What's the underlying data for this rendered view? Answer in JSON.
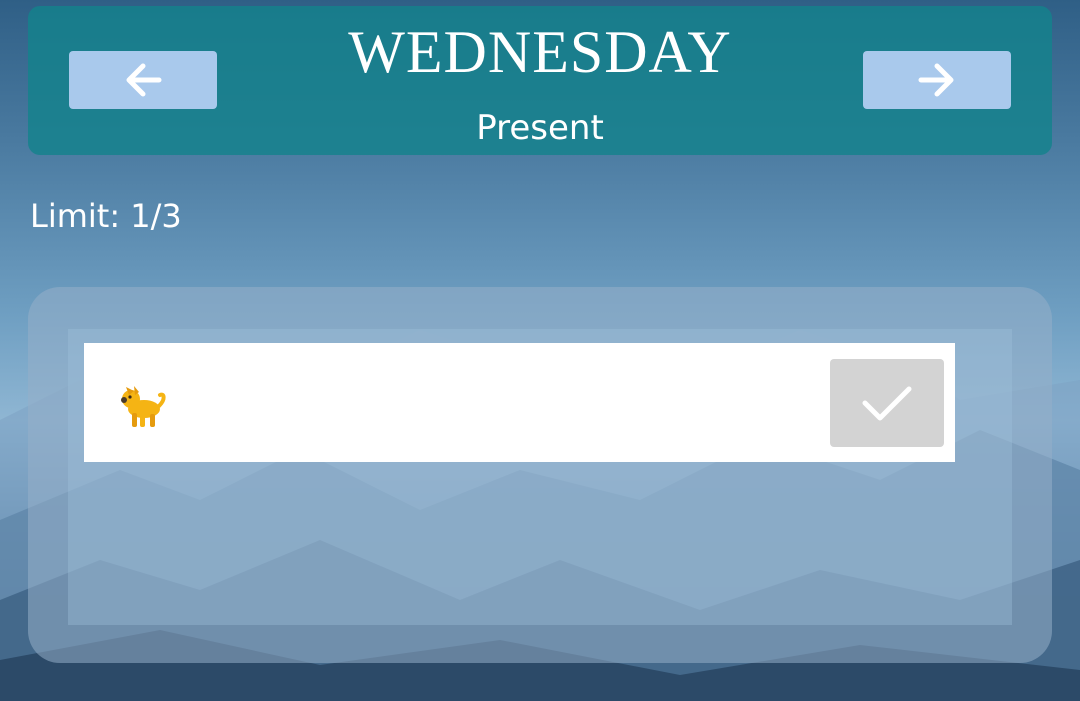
{
  "header": {
    "day": "WEDNESDAY",
    "subtitle": "Present",
    "prev_icon": "arrow-left-icon",
    "next_icon": "arrow-right-icon"
  },
  "limit": {
    "text": "Limit: 1/3"
  },
  "tasks": [
    {
      "emoji": "🐕",
      "emoji_icon": "dog-icon",
      "check_icon": "checkmark-icon"
    }
  ],
  "colors": {
    "header_bg": "#14828c",
    "nav_button_bg": "#a9c9ec",
    "check_button_bg": "#d3d3d3",
    "text": "#ffffff"
  }
}
